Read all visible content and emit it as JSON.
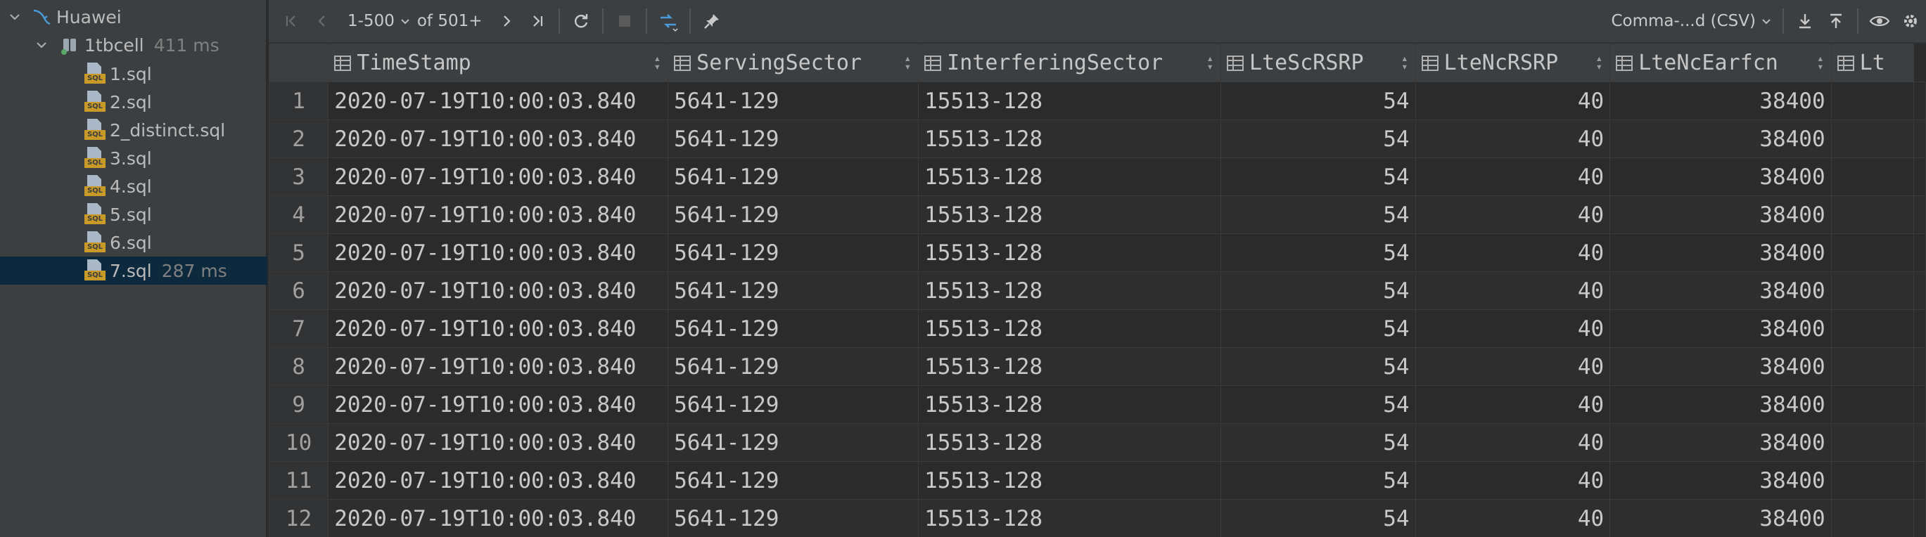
{
  "tree": {
    "root": {
      "label": "Huawei"
    },
    "datasource": {
      "label": "1tbcell",
      "timing": "411 ms"
    },
    "files": [
      {
        "label": "1.sql",
        "timing": ""
      },
      {
        "label": "2.sql",
        "timing": ""
      },
      {
        "label": "2_distinct.sql",
        "timing": ""
      },
      {
        "label": "3.sql",
        "timing": ""
      },
      {
        "label": "4.sql",
        "timing": ""
      },
      {
        "label": "5.sql",
        "timing": ""
      },
      {
        "label": "6.sql",
        "timing": ""
      },
      {
        "label": "7.sql",
        "timing": "287 ms",
        "selected": true
      }
    ]
  },
  "toolbar": {
    "page_range": "1-500",
    "page_total": "of 501+",
    "export_format": "Comma-...d (CSV)"
  },
  "grid": {
    "columns": [
      {
        "name": "TimeStamp",
        "align": "left"
      },
      {
        "name": "ServingSector",
        "align": "left"
      },
      {
        "name": "InterferingSector",
        "align": "left"
      },
      {
        "name": "LteScRSRP",
        "align": "right"
      },
      {
        "name": "LteNcRSRP",
        "align": "right"
      },
      {
        "name": "LteNcEarfcn",
        "align": "right"
      },
      {
        "name": "Lt",
        "align": "left"
      }
    ],
    "rows": [
      {
        "n": "1",
        "cells": [
          "2020-07-19T10:00:03.840",
          "5641-129",
          "15513-128",
          "54",
          "40",
          "38400",
          ""
        ]
      },
      {
        "n": "2",
        "cells": [
          "2020-07-19T10:00:03.840",
          "5641-129",
          "15513-128",
          "54",
          "40",
          "38400",
          ""
        ]
      },
      {
        "n": "3",
        "cells": [
          "2020-07-19T10:00:03.840",
          "5641-129",
          "15513-128",
          "54",
          "40",
          "38400",
          ""
        ]
      },
      {
        "n": "4",
        "cells": [
          "2020-07-19T10:00:03.840",
          "5641-129",
          "15513-128",
          "54",
          "40",
          "38400",
          ""
        ]
      },
      {
        "n": "5",
        "cells": [
          "2020-07-19T10:00:03.840",
          "5641-129",
          "15513-128",
          "54",
          "40",
          "38400",
          ""
        ]
      },
      {
        "n": "6",
        "cells": [
          "2020-07-19T10:00:03.840",
          "5641-129",
          "15513-128",
          "54",
          "40",
          "38400",
          ""
        ]
      },
      {
        "n": "7",
        "cells": [
          "2020-07-19T10:00:03.840",
          "5641-129",
          "15513-128",
          "54",
          "40",
          "38400",
          ""
        ]
      },
      {
        "n": "8",
        "cells": [
          "2020-07-19T10:00:03.840",
          "5641-129",
          "15513-128",
          "54",
          "40",
          "38400",
          ""
        ]
      },
      {
        "n": "9",
        "cells": [
          "2020-07-19T10:00:03.840",
          "5641-129",
          "15513-128",
          "54",
          "40",
          "38400",
          ""
        ]
      },
      {
        "n": "10",
        "cells": [
          "2020-07-19T10:00:03.840",
          "5641-129",
          "15513-128",
          "54",
          "40",
          "38400",
          ""
        ]
      },
      {
        "n": "11",
        "cells": [
          "2020-07-19T10:00:03.840",
          "5641-129",
          "15513-128",
          "54",
          "40",
          "38400",
          ""
        ]
      },
      {
        "n": "12",
        "cells": [
          "2020-07-19T10:00:03.840",
          "5641-129",
          "15513-128",
          "54",
          "40",
          "38400",
          ""
        ]
      }
    ]
  },
  "colors": {
    "panel": "#3c3f41",
    "grid_bg": "#2b2b2b",
    "selection": "#0d293e",
    "accent_blue": "#4a9bd8",
    "sql_tag": "#c99a28"
  }
}
